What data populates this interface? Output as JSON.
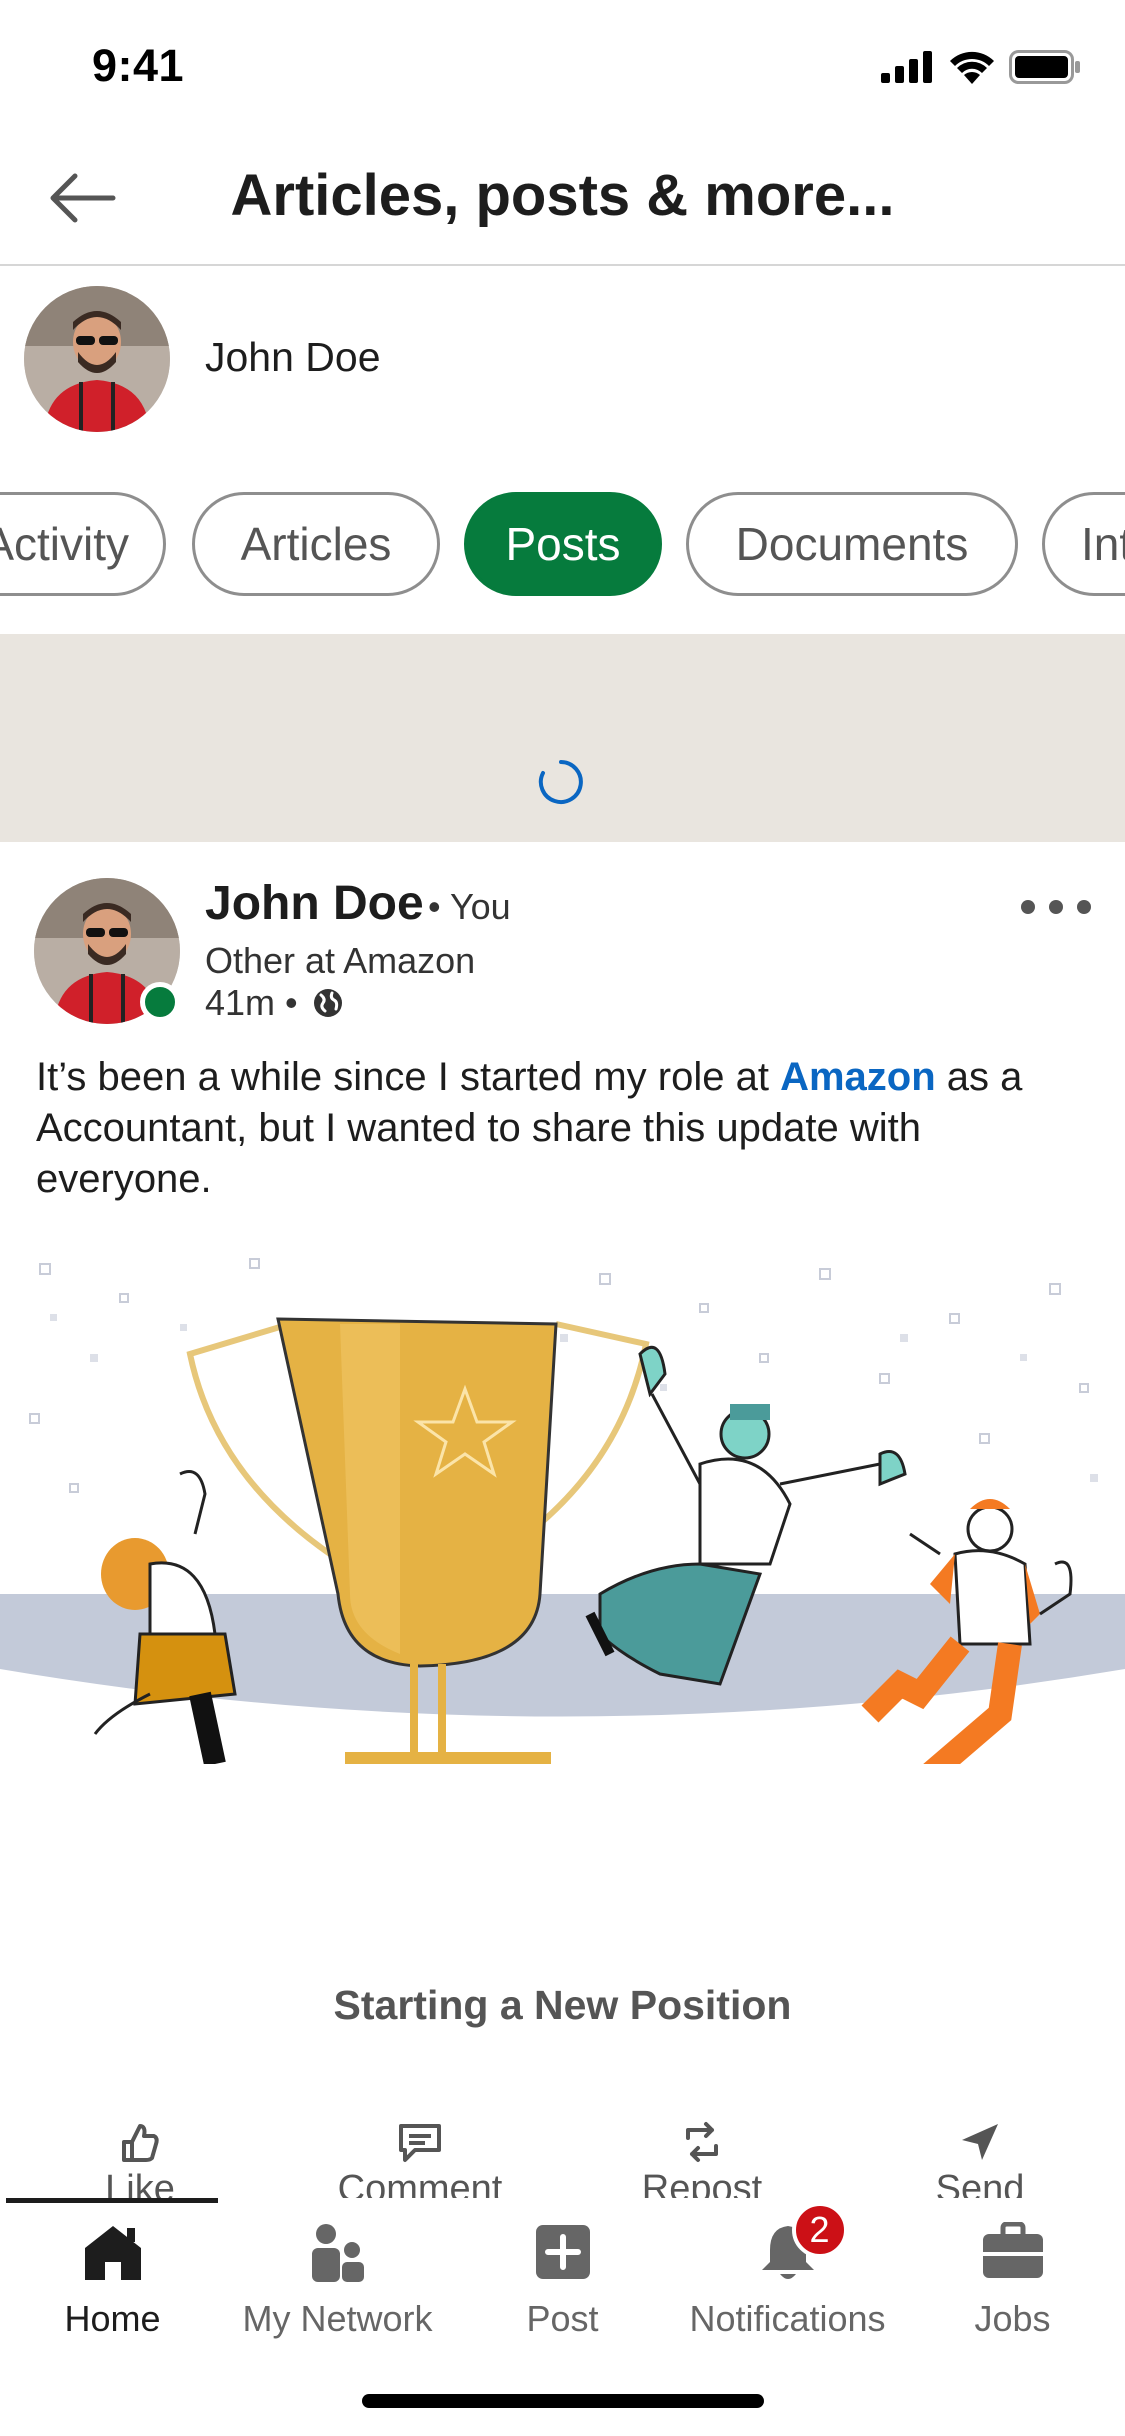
{
  "status_bar": {
    "time": "9:41"
  },
  "header": {
    "title": "Articles, posts & more..."
  },
  "profile": {
    "name": "John Doe"
  },
  "chips": [
    {
      "label": "Activity",
      "active": false
    },
    {
      "label": "Articles",
      "active": false
    },
    {
      "label": "Posts",
      "active": true
    },
    {
      "label": "Documents",
      "active": false
    },
    {
      "label": "Interests",
      "active": false
    }
  ],
  "post": {
    "author": "John Doe",
    "you_label": "• You",
    "headline": "Other at Amazon",
    "time": "41m •",
    "text_before": "It’s been a while since I started my role at ",
    "mention": "Amazon",
    "text_after": " as a Accountant, but I wanted to share this update with everyone.",
    "caption": "Starting a New Position"
  },
  "actions": {
    "like": "Like",
    "comment": "Comment",
    "repost": "Repost",
    "send": "Send"
  },
  "bottom_nav": {
    "home": "Home",
    "my_network": "My Network",
    "post": "Post",
    "notifications": "Notifications",
    "jobs": "Jobs",
    "notifications_badge": "2"
  },
  "colors": {
    "accent_green": "#067b3d",
    "link_blue": "#0a66c2",
    "badge_red": "#cc1016",
    "loading_bg": "#e9e5df"
  }
}
